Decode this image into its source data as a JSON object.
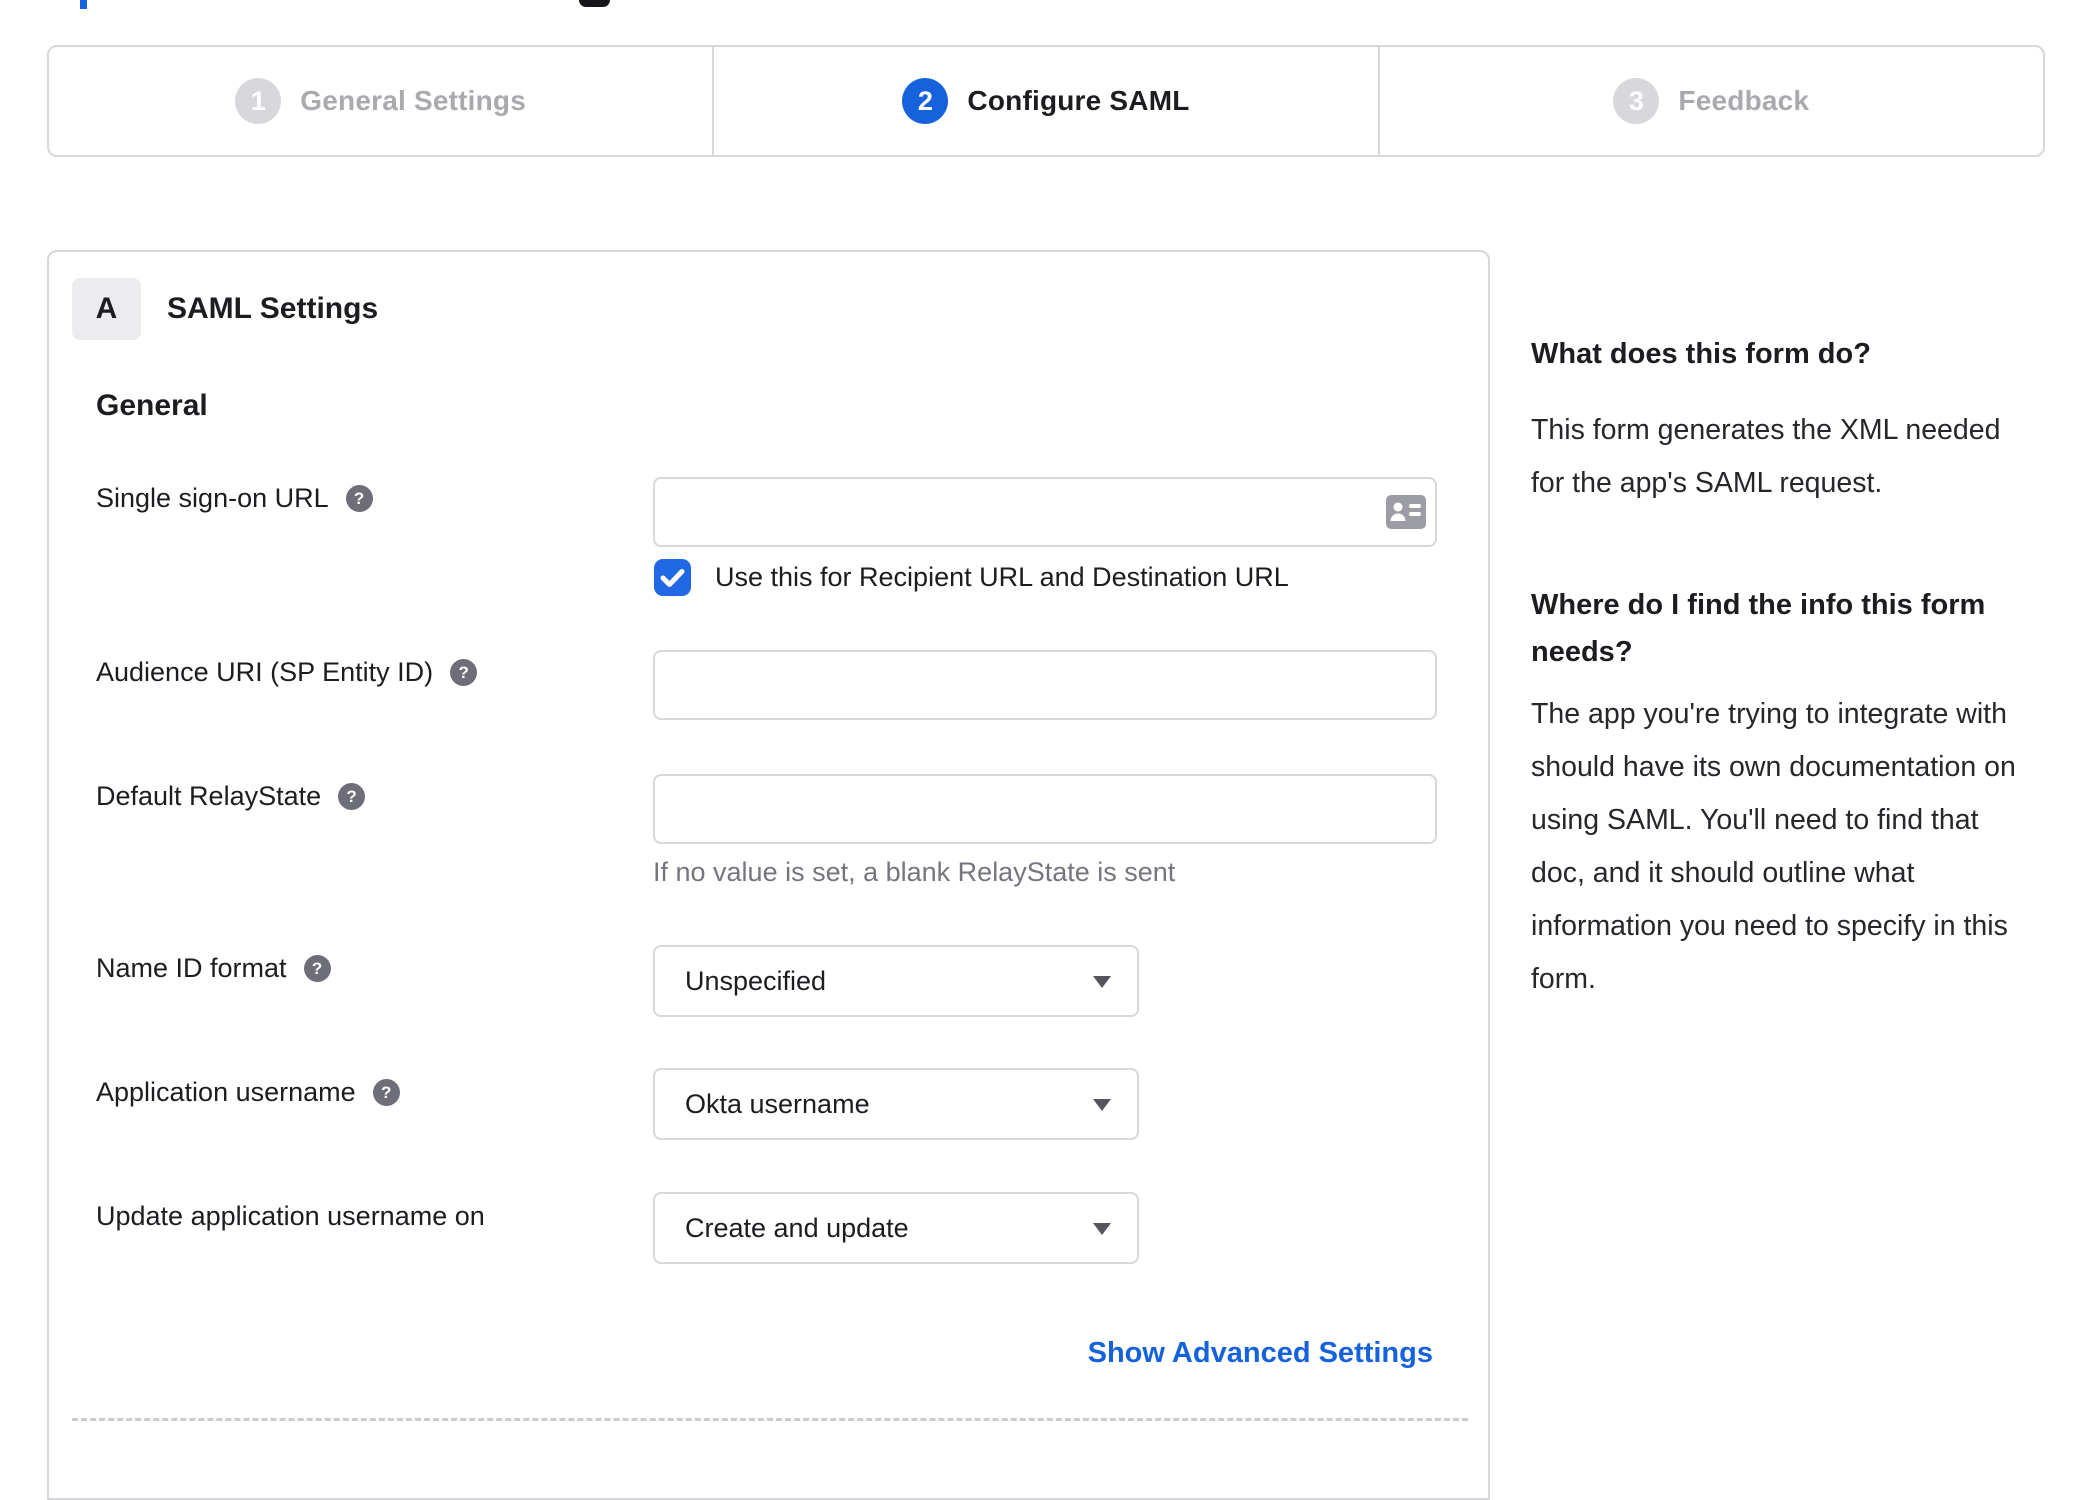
{
  "stepper": {
    "steps": [
      {
        "number": "1",
        "label": "General Settings",
        "state": "inactive"
      },
      {
        "number": "2",
        "label": "Configure SAML",
        "state": "active"
      },
      {
        "number": "3",
        "label": "Feedback",
        "state": "inactive"
      }
    ]
  },
  "panel": {
    "section_badge": "A",
    "section_title": "SAML Settings",
    "group_heading": "General",
    "fields": {
      "sso_url": {
        "label": "Single sign-on URL",
        "value": "",
        "checkbox_label": "Use this for Recipient URL and Destination URL",
        "checkbox_checked": true
      },
      "audience_uri": {
        "label": "Audience URI (SP Entity ID)",
        "value": ""
      },
      "default_relaystate": {
        "label": "Default RelayState",
        "value": "",
        "hint": "If no value is set, a blank RelayState is sent"
      },
      "name_id_format": {
        "label": "Name ID format",
        "value": "Unspecified"
      },
      "application_username": {
        "label": "Application username",
        "value": "Okta username"
      },
      "update_application_username_on": {
        "label": "Update application username on",
        "value": "Create and update"
      }
    },
    "advanced_link": "Show Advanced Settings"
  },
  "sidebar": {
    "heading1": "What does this form do?",
    "paragraph1": "This form generates the XML needed\nfor the app's SAML request.",
    "heading2": "Where do I find the info this form\nneeds?",
    "paragraph2": "The app you're trying to integrate with\nshould have its own documentation on\nusing SAML. You'll need to find that\ndoc, and it should outline what\ninformation you need to specify in this\nform."
  },
  "icons": {
    "question_glyph": "?"
  },
  "colors": {
    "accent_blue": "#1662dd",
    "checkbox_blue": "#2068e4",
    "inactive_gray": "#d7d7dc",
    "inactive_text": "#a8aaae",
    "text_dark": "#1d1d21",
    "muted_text": "#75757d",
    "help_icon_bg": "#6e6e78",
    "border_gray": "#d7d7dc"
  }
}
